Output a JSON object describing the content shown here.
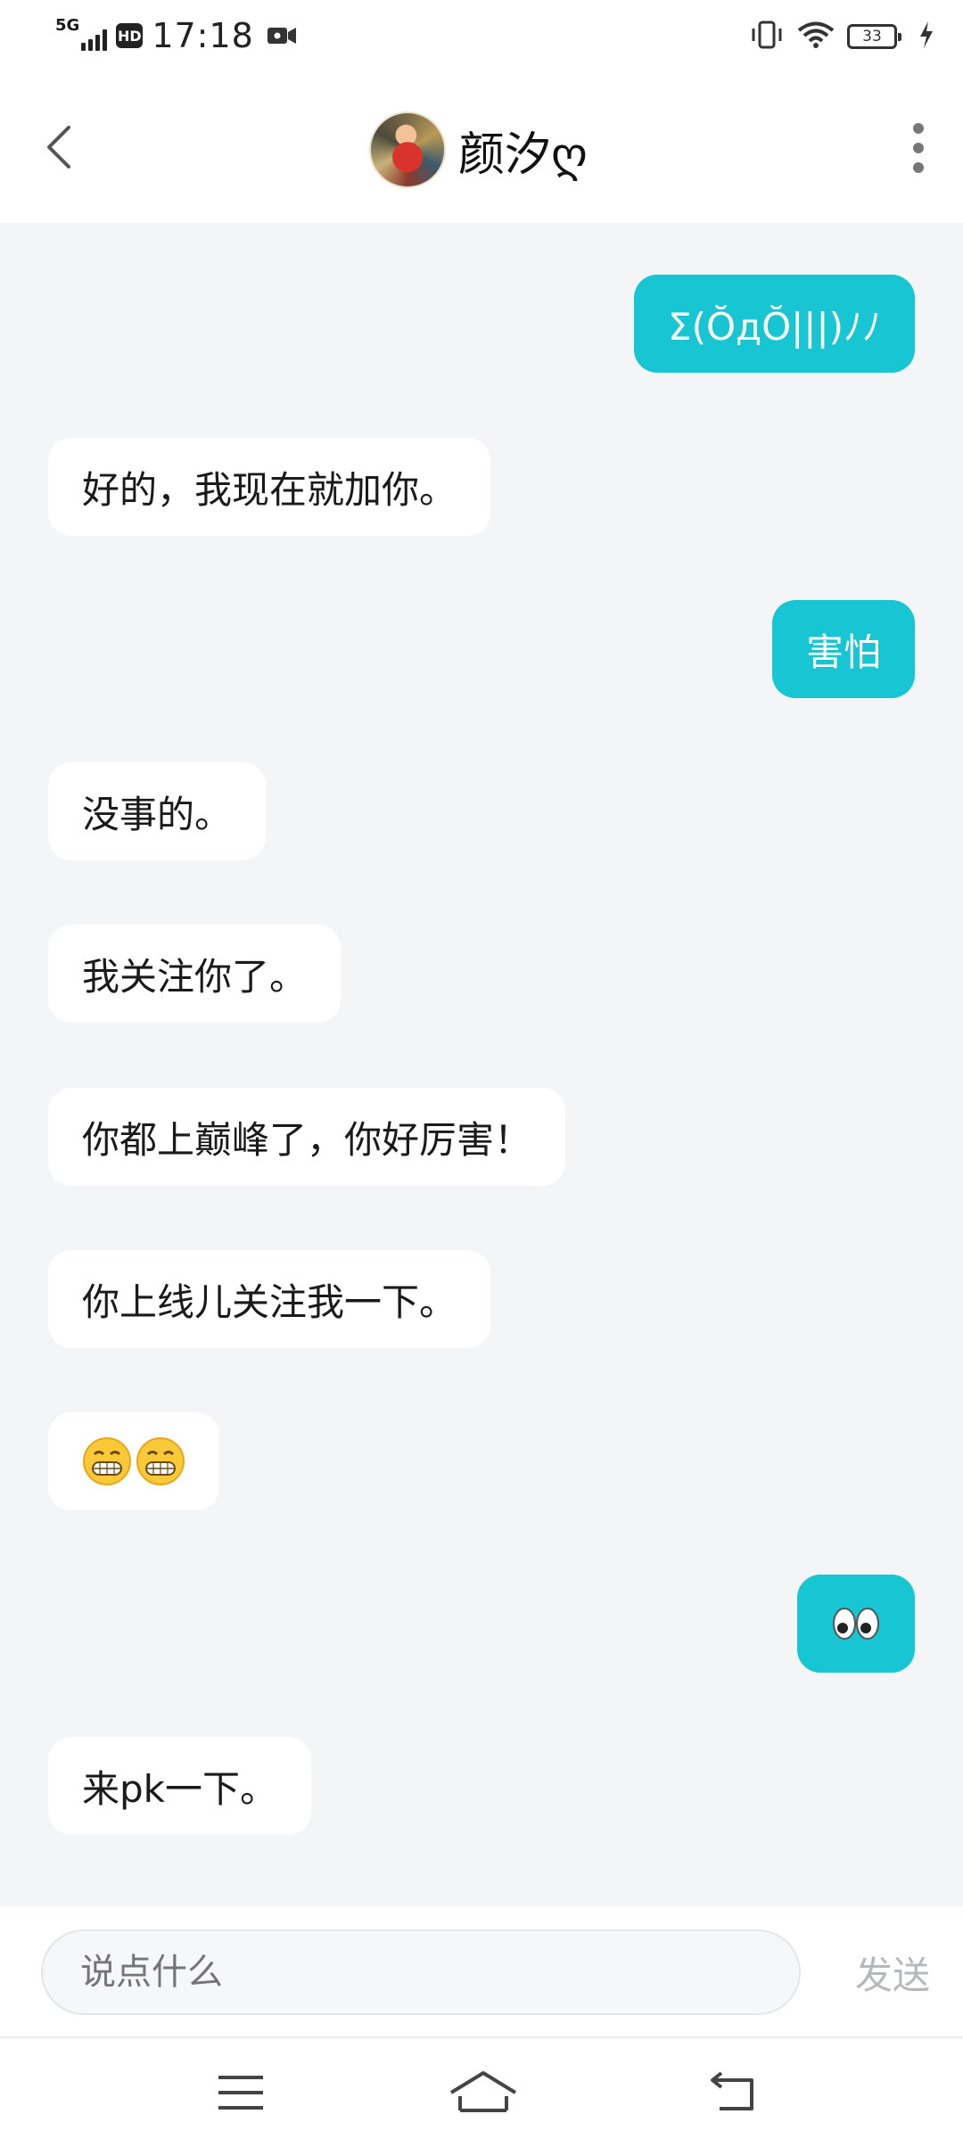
{
  "status_bar": {
    "network": "5G",
    "hd_label": "HD",
    "time": "17:18",
    "battery_level": "33",
    "icons": [
      "signal-icon",
      "hd-icon",
      "video-recording-icon",
      "vibrate-icon",
      "wifi-icon",
      "battery-icon",
      "charging-icon"
    ]
  },
  "header": {
    "peer_name": "颜汐ღ",
    "icons": [
      "back-icon",
      "avatar",
      "more-icon"
    ]
  },
  "messages": [
    {
      "side": "out",
      "text": "Σ(ŎдŎ|||)ﾉﾉ"
    },
    {
      "side": "in",
      "text": "好的，我现在就加你。"
    },
    {
      "side": "out",
      "text": "害怕"
    },
    {
      "side": "in",
      "text": "没事的。"
    },
    {
      "side": "in",
      "text": "我关注你了。"
    },
    {
      "side": "in",
      "text": "你都上巅峰了，你好厉害！"
    },
    {
      "side": "in",
      "text": "你上线儿关注我一下。"
    },
    {
      "side": "in",
      "text": "",
      "emoji": "grinning-face-emoji x2"
    },
    {
      "side": "out",
      "text": "",
      "emoji": "eyes-emoji"
    },
    {
      "side": "in",
      "text": "来pk一下。"
    }
  ],
  "composer": {
    "placeholder": "说点什么",
    "send_label": "发送"
  },
  "colors": {
    "outgoing_bubble": "#17c6d2",
    "incoming_bubble": "#ffffff",
    "chat_background": "#f4f5f7"
  }
}
